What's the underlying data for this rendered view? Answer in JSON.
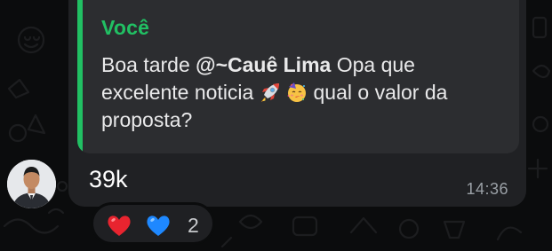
{
  "message": {
    "quote": {
      "author": "Você",
      "text_before": "Boa tarde ",
      "mention": "@~Cauê Lima",
      "text_mid": " Opa que excelente noticia ",
      "text_after": " qual o valor da proposta?",
      "emojis": [
        "rocket-emoji",
        "partying-face-emoji"
      ]
    },
    "reply_text": "39k",
    "time": "14:36"
  },
  "reactions": {
    "emojis": [
      "red-heart-emoji",
      "blue-heart-emoji"
    ],
    "count": "2"
  },
  "colors": {
    "accent": "#21c063",
    "bubble": "#202124",
    "quote_bg": "#2c2d30",
    "background": "#0b0c0d"
  }
}
